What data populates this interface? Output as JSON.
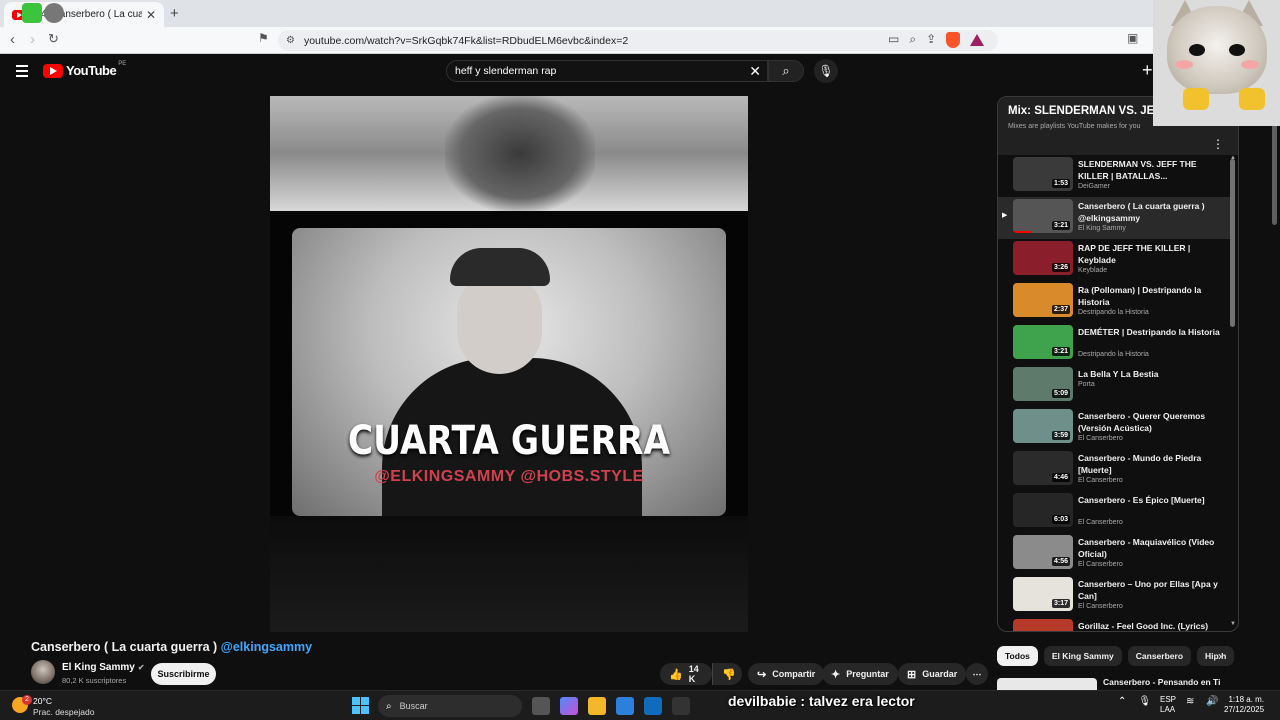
{
  "browser": {
    "tab_title": "(24) Canserbero ( La cuarta gu",
    "tab_close": "✕",
    "new_tab": "+",
    "url": "youtube.com/watch?v=SrkGqbk74Fk&list=RDbudELM6evbc&index=2"
  },
  "header": {
    "logo": "YouTube",
    "logo_country": "PE",
    "search_value": "heff y slenderman rap",
    "clear_icon": "✕"
  },
  "video": {
    "overlay_title": "CUARTA GUERRA",
    "overlay_subtitle": "@ELKINGSAMMY @HOBS.STYLE",
    "title": "Canserbero ( La cuarta guerra )",
    "title_handle": "@elkingsammy",
    "channel": "El King Sammy",
    "subscribers": "80,2 K suscriptores",
    "subscribe_label": "Suscribirme",
    "likes": "14 K",
    "share_label": "Compartir",
    "ask_label": "Preguntar",
    "save_label": "Guardar"
  },
  "playlist": {
    "title": "Mix: SLENDERMAN VS. JEFF",
    "subtitle": "Mixes are playlists YouTube makes for you",
    "items": [
      {
        "title": "SLENDERMAN VS. JEFF THE KILLER | BATALLAS...",
        "channel": "DeiGamer",
        "duration": "1:53",
        "progress": 0.0,
        "thumb": "#3a3a3a",
        "active": false
      },
      {
        "title": "Canserbero ( La cuarta guerra ) @elkingsammy",
        "channel": "El King Sammy",
        "duration": "3:21",
        "progress": 0.3,
        "thumb": "#555555",
        "active": true
      },
      {
        "title": "RAP DE JEFF THE KILLER | Keyblade",
        "channel": "Keyblade",
        "duration": "3:26",
        "progress": 0.0,
        "thumb": "#8a1f2b",
        "active": false
      },
      {
        "title": "Ra (Polloman) | Destripando la Historia",
        "channel": "Destripando la Historia",
        "duration": "2:37",
        "progress": 0.0,
        "thumb": "#d98a2a",
        "active": false
      },
      {
        "title": "DEMÉTER | Destripando la Historia",
        "channel": "Destripando la Historia",
        "duration": "3:21",
        "progress": 0.0,
        "thumb": "#3fa34d",
        "active": false
      },
      {
        "title": "La Bella Y La Bestia",
        "channel": "Porta",
        "duration": "5:09",
        "progress": 0.0,
        "thumb": "#5d7a6a",
        "active": false
      },
      {
        "title": "Canserbero - Querer Queremos (Versión Acústica)",
        "channel": "El Canserbero",
        "duration": "3:59",
        "progress": 0.0,
        "thumb": "#6f8f8a",
        "active": false
      },
      {
        "title": "Canserbero - Mundo de Piedra [Muerte]",
        "channel": "El Canserbero",
        "duration": "4:46",
        "progress": 0.0,
        "thumb": "#2b2b2b",
        "active": false
      },
      {
        "title": "Canserbero - Es Épico [Muerte]",
        "channel": "El Canserbero",
        "duration": "6:03",
        "progress": 0.0,
        "thumb": "#262626",
        "active": false
      },
      {
        "title": "Canserbero - Maquiavélico (Video Oficial)",
        "channel": "El Canserbero",
        "duration": "4:56",
        "progress": 0.0,
        "thumb": "#8b8b8b",
        "active": false
      },
      {
        "title": "Canserbero – Uno por Ellas [Apa y Can]",
        "channel": "El Canserbero",
        "duration": "3:17",
        "progress": 0.0,
        "thumb": "#e6e2dc",
        "active": false
      },
      {
        "title": "Gorillaz - Feel Good Inc. (Lyrics)",
        "channel": "",
        "duration": "",
        "progress": 0.0,
        "thumb": "#b53a2a",
        "active": false
      }
    ]
  },
  "chips": [
    "Todos",
    "El King Sammy",
    "Canserbero",
    "Hip h"
  ],
  "recommendation": {
    "title": "Canserbero - Pensando en Ti"
  },
  "taskbar": {
    "temp": "20°C",
    "condition": "Prac. despejado",
    "weather_badge": "2",
    "search_placeholder": "Buscar",
    "caption": "devilbabie : talvez era lector",
    "lang_1": "ESP",
    "lang_2": "LAA",
    "time": "1:18 a. m.",
    "date": "27/12/2025"
  },
  "colors": {
    "accent": "#ff0000",
    "link": "#3ea6ff",
    "background": "#0f0f0f"
  }
}
